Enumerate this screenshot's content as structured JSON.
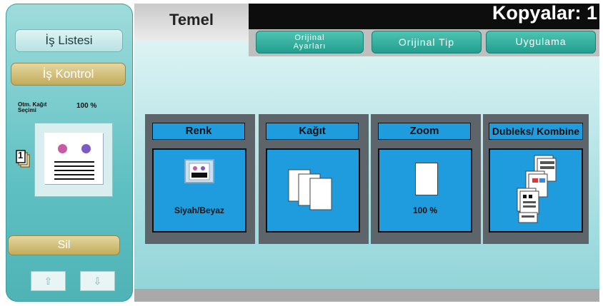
{
  "sidebar": {
    "job_list": "İş Listesi",
    "job_control": "İş Kontrol",
    "paper_selection_line1": "Otm. Kağıt",
    "paper_selection_line2": "Seçimi",
    "paper_zoom": "100 %",
    "stack_count": "1",
    "delete": "Sil",
    "up": "⇧",
    "down": "⇩"
  },
  "header": {
    "tab_main": "Temel",
    "copies": "Kopyalar: 1"
  },
  "subtabs": [
    {
      "line1": "Orijinal",
      "line2": "Ayarları"
    },
    {
      "label": "Orijinal Tip"
    },
    {
      "label": "Uygulama"
    }
  ],
  "functions": [
    {
      "title": "Renk",
      "value": "Siyah/Beyaz"
    },
    {
      "title": "Kağıt",
      "value": ""
    },
    {
      "title": "Zoom",
      "value": "100 %"
    },
    {
      "title": "Dubleks/ Kombine",
      "value": ""
    }
  ],
  "colors": {
    "accent": "#1e9cde",
    "panel": "#5d646a",
    "teal": "#229f8f",
    "gold": "#c2ab5a"
  }
}
